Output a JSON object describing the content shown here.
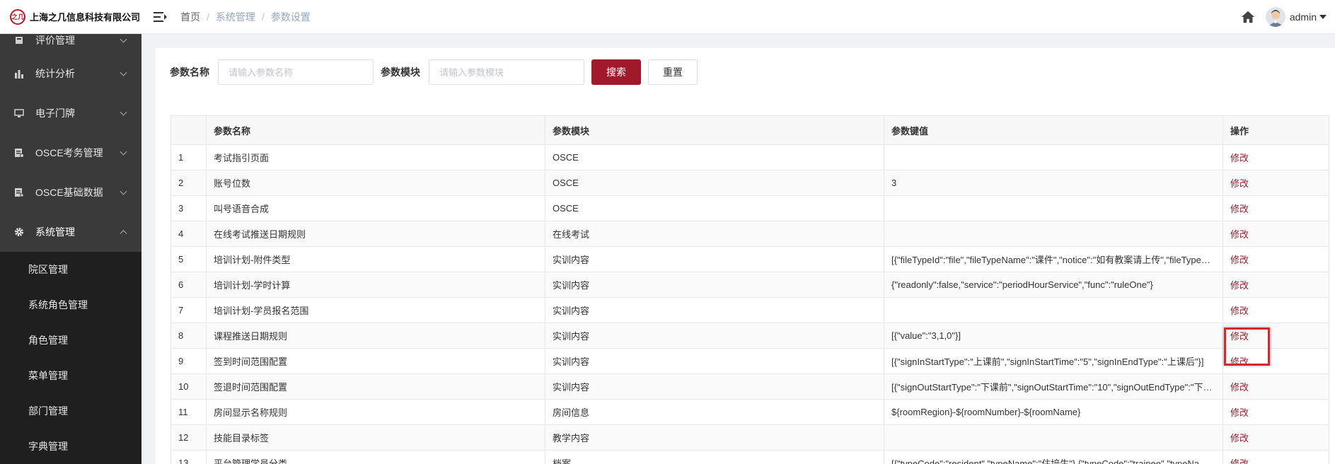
{
  "header": {
    "logo_mark": "之几",
    "logo_text": "上海之几信息科技有限公司",
    "breadcrumb": [
      "首页",
      "系统管理",
      "参数设置"
    ],
    "user_name": "admin"
  },
  "sidebar": {
    "items": [
      {
        "label": "评价管理",
        "icon": "star-icon"
      },
      {
        "label": "统计分析",
        "icon": "bar-chart-icon"
      },
      {
        "label": "电子门牌",
        "icon": "monitor-icon"
      },
      {
        "label": "OSCE考务管理",
        "icon": "document-icon"
      },
      {
        "label": "OSCE基础数据",
        "icon": "database-icon"
      },
      {
        "label": "系统管理",
        "icon": "gear-icon"
      }
    ],
    "sub_items": [
      "院区管理",
      "系统角色管理",
      "角色管理",
      "菜单管理",
      "部门管理",
      "字典管理"
    ]
  },
  "search": {
    "name_label": "参数名称",
    "name_placeholder": "请输入参数名称",
    "module_label": "参数模块",
    "module_placeholder": "请输入参数模块",
    "search_button": "搜索",
    "reset_button": "重置"
  },
  "table": {
    "columns": [
      "",
      "参数名称",
      "参数模块",
      "参数键值",
      "操作"
    ],
    "rows": [
      {
        "no": "1",
        "name": "考试指引页面",
        "module": "OSCE",
        "value": "",
        "op": "修改"
      },
      {
        "no": "2",
        "name": "账号位数",
        "module": "OSCE",
        "value": "3",
        "op": "修改"
      },
      {
        "no": "3",
        "name": "叫号语音合成",
        "module": "OSCE",
        "value": "",
        "op": "修改"
      },
      {
        "no": "4",
        "name": "在线考试推送日期规则",
        "module": "在线考试",
        "value": "",
        "op": "修改"
      },
      {
        "no": "5",
        "name": "培训计划-附件类型",
        "module": "实训内容",
        "value": "[{\"fileTypeId\":\"file\",\"fileTypeName\":\"课件\",\"notice\":\"如有教案请上传\",\"fileTypeDesc\":\"文件\"}]",
        "op": "修改"
      },
      {
        "no": "6",
        "name": "培训计划-学时计算",
        "module": "实训内容",
        "value": "{\"readonly\":false,\"service\":\"periodHourService\",\"func\":\"ruleOne\"}",
        "op": "修改"
      },
      {
        "no": "7",
        "name": "培训计划-学员报名范围",
        "module": "实训内容",
        "value": "",
        "op": "修改"
      },
      {
        "no": "8",
        "name": "课程推送日期规则",
        "module": "实训内容",
        "value": "[{\"value\":\"3,1,0\"}]",
        "op": "修改"
      },
      {
        "no": "9",
        "name": "签到时间范围配置",
        "module": "实训内容",
        "value": "[{\"signInStartType\":\"上课前\",\"signInStartTime\":\"5\",\"signInEndType\":\"上课后\"}]",
        "op": "修改"
      },
      {
        "no": "10",
        "name": "签退时间范围配置",
        "module": "实训内容",
        "value": "[{\"signOutStartType\":\"下课前\",\"signOutStartTime\":\"10\",\"signOutEndType\":\"下课后\"}]",
        "op": "修改"
      },
      {
        "no": "11",
        "name": "房间显示名称规则",
        "module": "房间信息",
        "value": "${roomRegion}-${roomNumber}-${roomName}",
        "op": "修改"
      },
      {
        "no": "12",
        "name": "技能目录标签",
        "module": "教学内容",
        "value": "",
        "op": "修改"
      },
      {
        "no": "13",
        "name": "平台管理学员分类",
        "module": "档案",
        "value": "[{\"typeCode\":\"resident\",\"typeName\":\"住培生\"},{\"typeCode\":\"trainee\",\"typeName\":\"进修生\"}]",
        "op": "修改"
      }
    ]
  },
  "colors": {
    "primary": "#a11a2b",
    "sidebar_bg": "#3a3a3a",
    "submenu_bg": "#1f1f1f",
    "highlight": "#d9262b"
  }
}
